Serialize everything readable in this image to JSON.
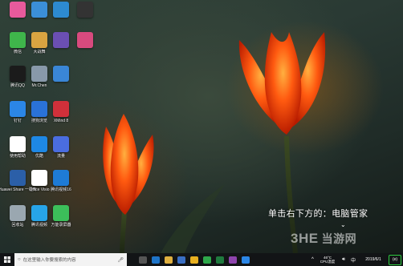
{
  "desktop": {
    "icons": [
      {
        "label": "",
        "icon": "colorful-wheel-icon",
        "color": "#e85a9c"
      },
      {
        "label": "",
        "icon": "computer-icon",
        "color": "#3b8fd8"
      },
      {
        "label": "",
        "icon": "network-icon",
        "color": "#2d8ad0"
      },
      {
        "label": "",
        "icon": "video-editor-icon",
        "color": "#333333"
      },
      {
        "label": "微信",
        "icon": "wechat-icon",
        "color": "#3fb64b"
      },
      {
        "label": "大战舞",
        "icon": "folder-icon",
        "color": "#d9a441"
      },
      {
        "label": "",
        "icon": "xmind-icon",
        "color": "#6b4fb3"
      },
      {
        "label": "",
        "icon": "photo-app-icon",
        "color": "#d84a7e"
      },
      {
        "label": "腾讯QQ",
        "icon": "qq-icon",
        "color": "#1b1b1b"
      },
      {
        "label": "Mr.Chen",
        "icon": "user-folder-icon",
        "color": "#8899aa"
      },
      {
        "label": "",
        "icon": "phone-assistant-icon",
        "color": "#3a86d6"
      },
      {
        "label": "",
        "icon": "blank-icon",
        "color": "transparent"
      },
      {
        "label": "钉钉",
        "icon": "dingtalk-icon",
        "color": "#2b86e6"
      },
      {
        "label": "搜狗浏览",
        "icon": "sogou-browser-icon",
        "color": "#2a72d8"
      },
      {
        "label": "XMind 8",
        "icon": "xmind8-icon",
        "color": "#d0303a"
      },
      {
        "label": "",
        "icon": "blank-icon",
        "color": "transparent"
      },
      {
        "label": "使用帮助",
        "icon": "document-icon",
        "color": "#ffffff"
      },
      {
        "label": "优酷",
        "icon": "youku-icon",
        "color": "#1e88e5"
      },
      {
        "label": "流量",
        "icon": "feather-icon",
        "color": "#4a6de0"
      },
      {
        "label": "",
        "icon": "blank-icon",
        "color": "transparent"
      },
      {
        "label": "Huawei Share 一碰传",
        "icon": "huawei-share-icon",
        "color": "#2b5fa8"
      },
      {
        "label": "Office Visio",
        "icon": "visio-document-icon",
        "color": "#ffffff"
      },
      {
        "label": "腾讯视频16",
        "icon": "windows-app-icon",
        "color": "#1e7bd6"
      },
      {
        "label": "",
        "icon": "blank-icon",
        "color": "transparent"
      },
      {
        "label": "回收站",
        "icon": "recycle-bin-icon",
        "color": "#9aa7b0"
      },
      {
        "label": "腾讯视频",
        "icon": "tencent-video-icon",
        "color": "#27a4e8"
      },
      {
        "label": "万能录屏器",
        "icon": "screen-recorder-icon",
        "color": "#3cbf5a"
      },
      {
        "label": "",
        "icon": "blank-icon",
        "color": "transparent"
      }
    ],
    "tip_text": "单击右下方的：电脑管家",
    "watermark_brand": "3HE",
    "watermark_cn": "当游网"
  },
  "taskbar": {
    "search_placeholder": "在这里输入你要搜索的内容",
    "apps": [
      {
        "icon": "task-view-icon",
        "color": "#555555"
      },
      {
        "icon": "edge-icon",
        "color": "#1e74c8"
      },
      {
        "icon": "file-explorer-icon",
        "color": "#e0b040"
      },
      {
        "icon": "store-icon",
        "color": "#3a6fc4"
      },
      {
        "icon": "chrome-icon",
        "color": "#e8b020"
      },
      {
        "icon": "green-app-icon",
        "color": "#2ea84a"
      },
      {
        "icon": "excel-icon",
        "color": "#1f7a3e"
      },
      {
        "icon": "purple-app-icon",
        "color": "#8e44ad"
      },
      {
        "icon": "chat-app-icon",
        "color": "#2b86e6"
      }
    ],
    "cpu_temp": "46°C",
    "cpu_label": "CPU温度",
    "date": "2019/6/1",
    "badge": "(e)"
  }
}
